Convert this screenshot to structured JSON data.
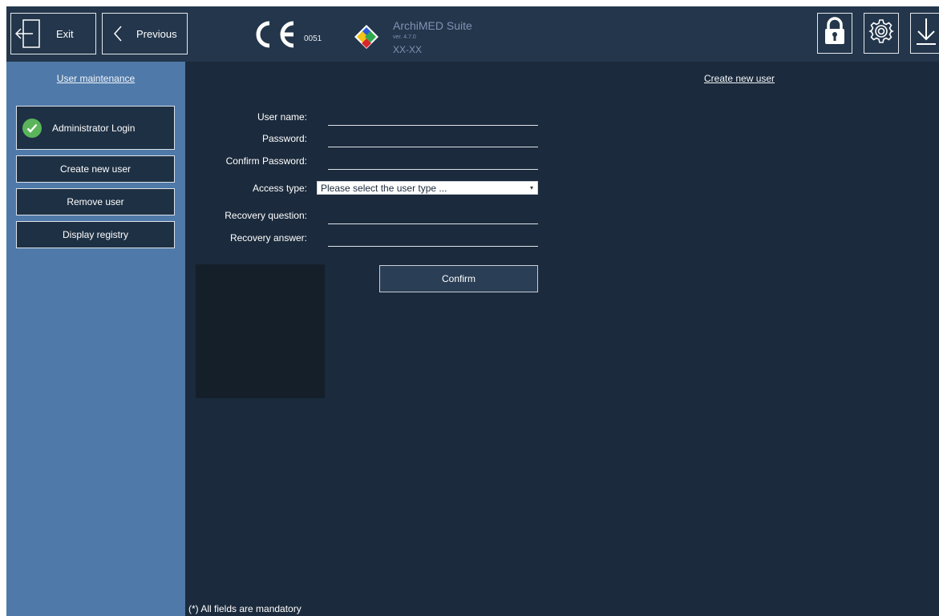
{
  "toolbar": {
    "exit_label": "Exit",
    "previous_label": "Previous"
  },
  "brand": {
    "ce_number": "0051",
    "title": "ArchiMED Suite",
    "version": "ver. 4.7.0",
    "subtitle": "XX-XX"
  },
  "sidebar": {
    "title": "User maintenance",
    "items": [
      {
        "label": "Administrator Login",
        "icon": "check-circle-icon",
        "status_color": "#5ab55a"
      },
      {
        "label": "Create new user"
      },
      {
        "label": "Remove user"
      },
      {
        "label": "Display registry"
      }
    ]
  },
  "main": {
    "title": "Create new user",
    "form": {
      "username_label": "User name:",
      "username_value": "",
      "password_label": "Password:",
      "password_value": "",
      "confirm_password_label": "Confirm Password:",
      "confirm_password_value": "",
      "access_type_label": "Access type:",
      "access_type_value": "Please select the user type ...",
      "recovery_question_label": "Recovery question:",
      "recovery_question_value": "",
      "recovery_answer_label": "Recovery answer:",
      "recovery_answer_value": ""
    },
    "confirm_label": "Confirm",
    "footnote": "(*) All fields are mandatory"
  },
  "colors": {
    "topbar": "#23364b",
    "sidebar": "#4f79a8",
    "main_bg": "#1b2a3c",
    "success": "#5ab55a"
  }
}
